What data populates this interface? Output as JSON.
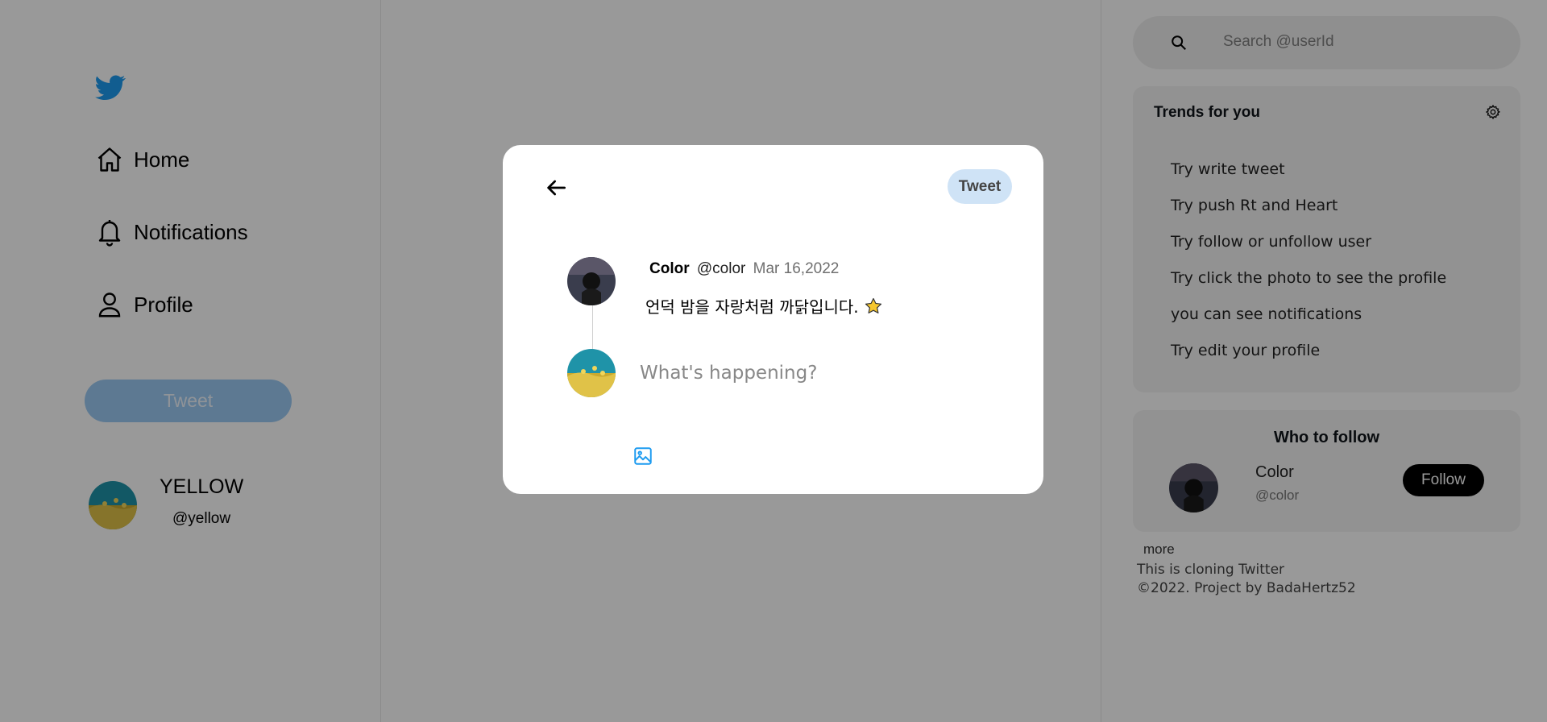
{
  "sidebar": {
    "nav": [
      {
        "label": "Home",
        "icon": "home-icon"
      },
      {
        "label": "Notifications",
        "icon": "bell-icon"
      },
      {
        "label": "Profile",
        "icon": "person-icon"
      }
    ],
    "tweet_button": "Tweet",
    "user": {
      "name": "YELLOW",
      "handle": "@yellow"
    }
  },
  "search": {
    "placeholder": "Search  @userId"
  },
  "trends": {
    "title": "Trends for you",
    "items": [
      "Try write tweet",
      "Try push Rt and Heart",
      "Try follow or unfollow user",
      "Try click the photo to see the profile",
      "you can see notifications",
      "Try edit your profile"
    ]
  },
  "who_to_follow": {
    "title": "Who to follow",
    "user": {
      "name": "Color",
      "handle": "@color"
    },
    "follow_label": "Follow"
  },
  "footer": {
    "more": "more",
    "line1": "This is cloning Twitter",
    "line2": "©2022.  Project  by  BadaHertz52"
  },
  "modal": {
    "tweet_button": "Tweet",
    "original": {
      "name": "Color",
      "handle": "@color",
      "date": "Mar 16,2022",
      "text": "언덕 밤을 자랑처럼 까닭입니다."
    },
    "reply_placeholder": "What's happening?"
  },
  "colors": {
    "brand_blue": "#1d9bf0",
    "overlay": "rgba(0,0,0,0.4)"
  }
}
